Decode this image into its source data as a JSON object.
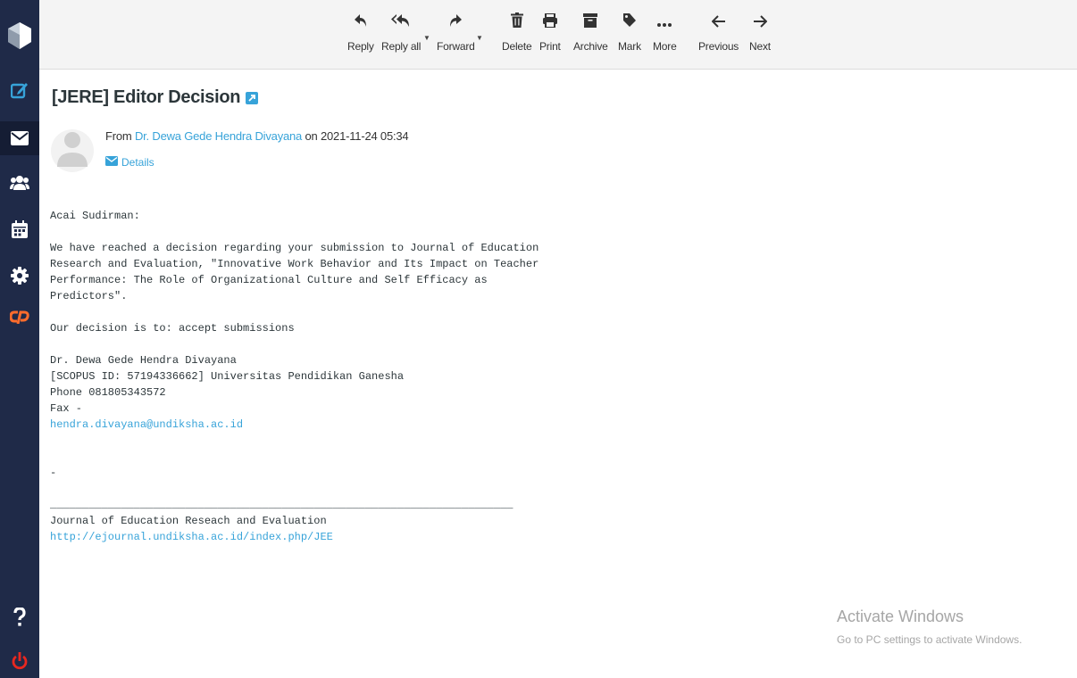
{
  "colors": {
    "sidebar": "#1f2a48",
    "sidebar_active": "#151d34",
    "accent": "#37a3d9",
    "logout": "#e8271f",
    "cpanel": "#ff6c2c"
  },
  "sidebar": {
    "items": [
      {
        "icon": "compose-icon"
      },
      {
        "icon": "mail-icon",
        "active": true
      },
      {
        "icon": "contacts-icon"
      },
      {
        "icon": "calendar-icon"
      },
      {
        "icon": "settings-icon"
      },
      {
        "icon": "cpanel-icon"
      },
      {
        "icon": "help-icon"
      },
      {
        "icon": "logout-icon"
      }
    ]
  },
  "toolbar": {
    "reply": "Reply",
    "reply_all": "Reply all",
    "forward": "Forward",
    "delete": "Delete",
    "print": "Print",
    "archive": "Archive",
    "mark": "Mark",
    "more": "More",
    "previous": "Previous",
    "next": "Next"
  },
  "message": {
    "subject": "[JERE] Editor Decision",
    "from_prefix": "From",
    "from_name": "Dr. Dewa Gede Hendra Divayana",
    "date_text": "on 2021-11-24 05:34",
    "details": "Details",
    "body": {
      "greeting": "Acai Sudirman:",
      "para1": "We have reached a decision regarding your submission to Journal of Education\nResearch and Evaluation, \"Innovative Work Behavior and Its Impact on Teacher\nPerformance: The Role of Organizational Culture and Self Efficacy as\nPredictors\".",
      "decision": "Our decision is to: accept submissions",
      "sig_name": "Dr. Dewa Gede Hendra Divayana",
      "sig_affil": "[SCOPUS ID: 57194336662] Universitas Pendidikan Ganesha",
      "sig_phone": "Phone 081805343572",
      "sig_fax": "Fax -",
      "sig_email": "hendra.divayana@undiksha.ac.id",
      "dash": "-",
      "rule": "________________________________________________________________________",
      "journal": "Journal of Education Reseach and Evaluation",
      "journal_url": "http://ejournal.undiksha.ac.id/index.php/JEE"
    }
  },
  "watermark": {
    "title": "Activate Windows",
    "subtitle": "Go to PC settings to activate Windows."
  }
}
